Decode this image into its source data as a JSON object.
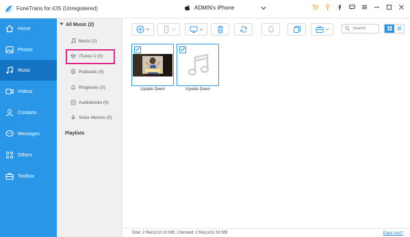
{
  "app": {
    "title": "FoneTrans for iOS (Unregistered)"
  },
  "device": {
    "name": "ADMIN's iPhone"
  },
  "titlebar_icons": [
    "cart-icon",
    "key-icon",
    "facebook-icon",
    "chat-icon",
    "menu-icon",
    "minimize-icon",
    "maximize-icon",
    "close-icon"
  ],
  "sidebar": {
    "items": [
      {
        "label": "Home",
        "icon": "home-icon"
      },
      {
        "label": "Photos",
        "icon": "photos-icon"
      },
      {
        "label": "Music",
        "icon": "music-icon",
        "active": true
      },
      {
        "label": "Videos",
        "icon": "videos-icon"
      },
      {
        "label": "Contacts",
        "icon": "contacts-icon"
      },
      {
        "label": "Messages",
        "icon": "messages-icon"
      },
      {
        "label": "Others",
        "icon": "others-icon"
      },
      {
        "label": "Toolbox",
        "icon": "toolbox-icon"
      }
    ]
  },
  "categories": {
    "header": "All Music (2)",
    "items": [
      {
        "label": "Music (2)"
      },
      {
        "label": "iTunes U (0)"
      },
      {
        "label": "Podcasts (0)"
      },
      {
        "label": "Ringtones (0)"
      },
      {
        "label": "Audiobooks (0)"
      },
      {
        "label": "Voice Memos (0)"
      }
    ],
    "playlists": "Playlists"
  },
  "search": {
    "placeholder": "Search"
  },
  "files": [
    {
      "name": "Upside Down",
      "has_artwork": true,
      "checked": true
    },
    {
      "name": "Upside Down",
      "has_artwork": false,
      "checked": true
    }
  ],
  "status": {
    "text": "Total: 2 file(s)/12.19 MB; Checked: 2 file(s)/12.19 MB",
    "link": "Data lost?"
  },
  "colors": {
    "accent": "#2a96e7",
    "active": "#1573c4",
    "highlight": "#e0248a"
  }
}
